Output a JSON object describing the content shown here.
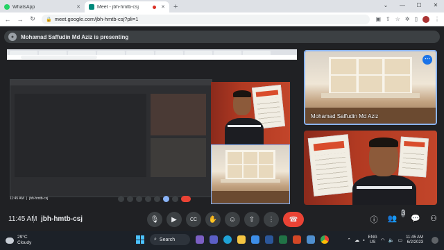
{
  "browser": {
    "tabs": [
      {
        "title": "WhatsApp",
        "favicon_color": "#25d366",
        "active": false,
        "recording": false
      },
      {
        "title": "Meet - jbh-hmtb-csj",
        "favicon_color": "#00897b",
        "active": true,
        "recording": true
      }
    ],
    "new_tab": "+",
    "url": "meet.google.com/jbh-hmtb-csj?pli=1"
  },
  "banner": {
    "text": "Mohamad Saffudin Md Aziz is presenting"
  },
  "presentation": {
    "time": "11:45 AM",
    "code": "jbh-hmtb-csj"
  },
  "participants": [
    {
      "name": "Mohamad Saffudin Md Aziz",
      "tile": "room"
    },
    {
      "name": "",
      "tile": "red"
    }
  ],
  "meeting": {
    "time": "11:45 AM",
    "separator": "|",
    "code": "jbh-hmtb-csj",
    "people_count": "3"
  },
  "taskbar": {
    "weather_temp": "29°C",
    "weather_desc": "Cloudy",
    "search_label": "Search",
    "lang_line1": "ENG",
    "lang_line2": "US",
    "clock_time": "11:45 AM",
    "clock_date": "6/2/2023"
  }
}
